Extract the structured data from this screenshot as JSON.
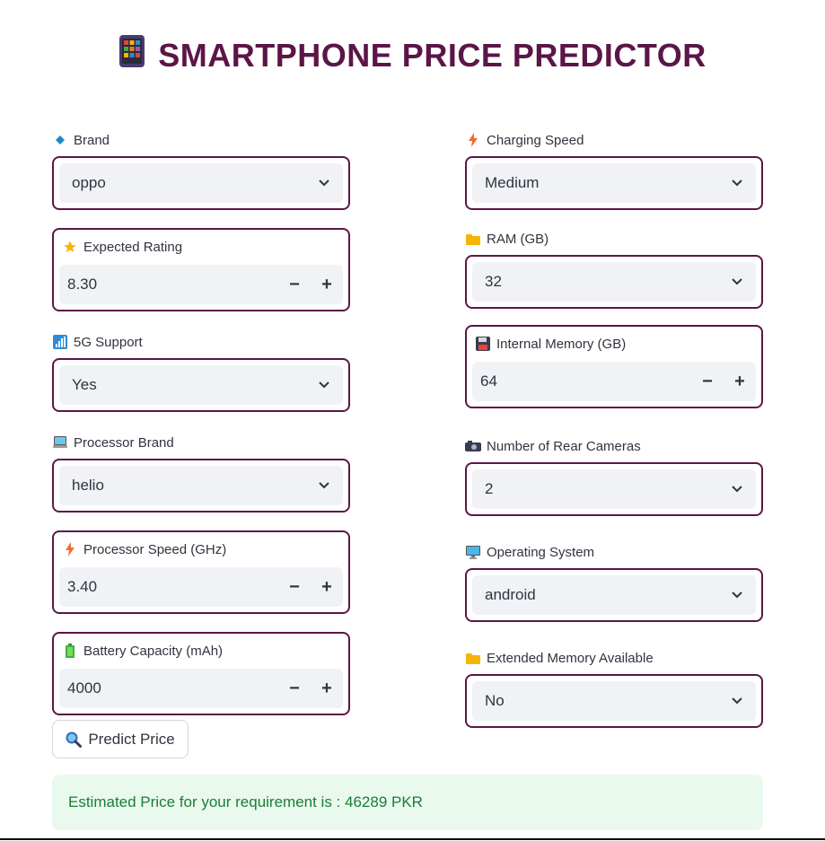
{
  "header": {
    "title": "SMARTPHONE PRICE PREDICTOR",
    "icon": "phone-icon"
  },
  "form": {
    "left": {
      "brand": {
        "label": "Brand",
        "value": "oppo",
        "icon": "diamond-icon"
      },
      "rating": {
        "label": "Expected Rating",
        "value": "8.30",
        "icon": "star-icon"
      },
      "fiveg": {
        "label": "5G Support",
        "value": "Yes",
        "icon": "signal-icon"
      },
      "processor_brand": {
        "label": "Processor Brand",
        "value": "helio",
        "icon": "laptop-icon"
      },
      "processor_speed": {
        "label": "Processor Speed (GHz)",
        "value": "3.40",
        "icon": "lightning-icon"
      },
      "battery": {
        "label": "Battery Capacity (mAh)",
        "value": "4000",
        "icon": "battery-icon"
      }
    },
    "right": {
      "charging": {
        "label": "Charging Speed",
        "value": "Medium",
        "icon": "lightning-icon"
      },
      "ram": {
        "label": "RAM (GB)",
        "value": "32",
        "icon": "folder-icon"
      },
      "internal_memory": {
        "label": "Internal Memory (GB)",
        "value": "64",
        "icon": "floppy-icon"
      },
      "rear_cameras": {
        "label": "Number of Rear Cameras",
        "value": "2",
        "icon": "camera-icon"
      },
      "os": {
        "label": "Operating System",
        "value": "android",
        "icon": "monitor-icon"
      },
      "extended_memory": {
        "label": "Extended Memory Available",
        "value": "No",
        "icon": "folder-icon"
      }
    },
    "stepper": {
      "minus": "−",
      "plus": "+"
    }
  },
  "actions": {
    "predict_label": "Predict Price",
    "icon": "magnifier-icon"
  },
  "result": {
    "text": "Estimated Price for your requirement is : 46289 PKR"
  },
  "colors": {
    "accent": "#5b1647",
    "input_bg": "#f0f2f6",
    "success_bg": "#e9f9ee",
    "success_text": "#1c7d37"
  }
}
